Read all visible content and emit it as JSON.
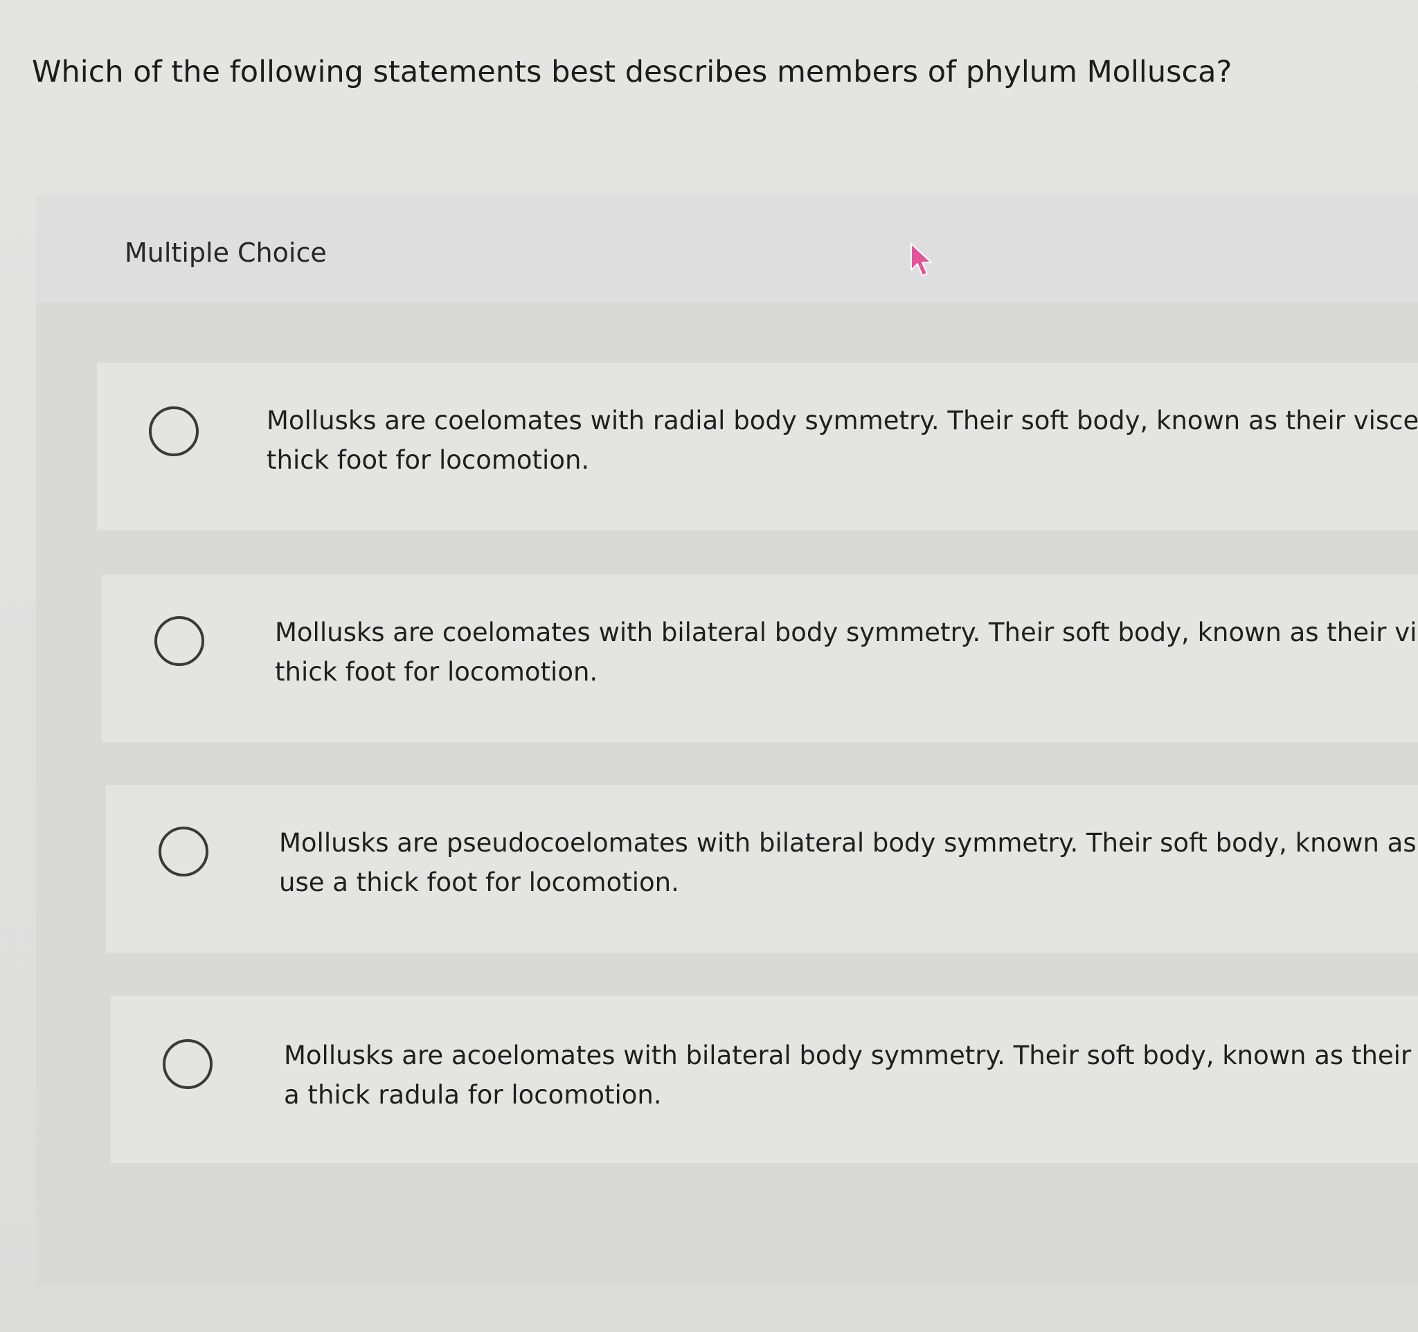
{
  "question": {
    "text": "Which of the following statements best describes members of phylum Mollusca?"
  },
  "panel": {
    "label": "Multiple Choice"
  },
  "options": [
    {
      "line1": "Mollusks are coelomates with radial body symmetry. Their soft body, known as their visceral mas",
      "line2": "thick foot for locomotion."
    },
    {
      "line1": "Mollusks are coelomates with bilateral body symmetry. Their soft body, known as their visceral m",
      "line2": "thick foot for locomotion."
    },
    {
      "line1": "Mollusks are pseudocoelomates with bilateral body symmetry. Their soft body, known as their vi",
      "line2": "use a thick foot for locomotion."
    },
    {
      "line1": "Mollusks are acoelomates with bilateral body symmetry. Their soft body, known as their viscera",
      "line2": "a thick radula for locomotion."
    }
  ],
  "icons": {
    "radio": "radio-unselected-icon",
    "cursor": "mouse-pointer-icon"
  },
  "colors": {
    "background": "#e2e2e1",
    "panel": "#d9d9d8",
    "option_card": "#e4e4e3",
    "radio_border": "#3a3a3a",
    "cursor": "#e0559b"
  }
}
